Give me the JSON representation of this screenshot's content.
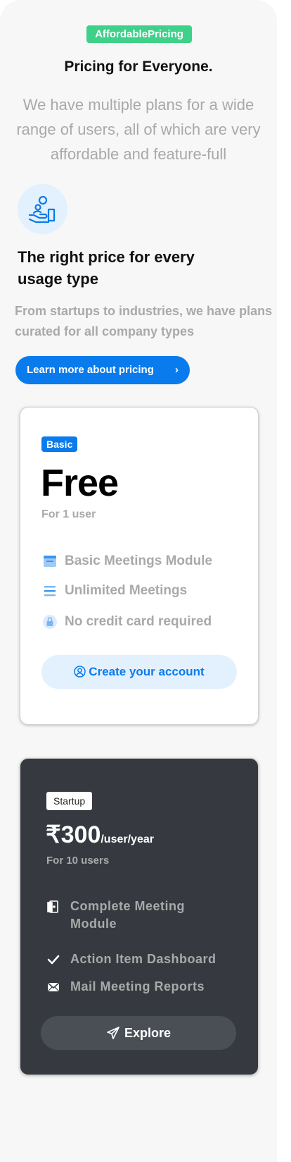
{
  "header": {
    "pill": "AffordablePricing",
    "title": "Pricing for Everyone.",
    "subtitle": "We have multiple plans for a wide range of users, all of which are very affordable and feature-full"
  },
  "feature_block": {
    "icon": "hand-coins-icon",
    "heading": "The right price for every usage type",
    "description": "From startups to industries, we have plans curated for all company types",
    "cta_label": "Learn more about pricing"
  },
  "plans": {
    "basic": {
      "badge": "Basic",
      "price": "Free",
      "users": "For 1 user",
      "features": [
        {
          "icon": "meeting-window-icon",
          "label": "Basic Meetings Module"
        },
        {
          "icon": "list-lines-icon",
          "label": "Unlimited Meetings"
        },
        {
          "icon": "lock-badge-icon",
          "label": "No credit card required"
        }
      ],
      "cta_label": "Create your account"
    },
    "startup": {
      "badge": "Startup",
      "price_amount": "₹300",
      "price_period": "/user/year",
      "users": "For 10 users",
      "features": [
        {
          "icon": "door-icon",
          "label": "Complete Meeting Module"
        },
        {
          "icon": "checkmark-icon",
          "label": "Action Item Dashboard"
        },
        {
          "icon": "mail-icon",
          "label": "Mail Meeting Reports"
        }
      ],
      "cta_label": "Explore"
    }
  },
  "colors": {
    "accent": "#0a7bec",
    "pill_green": "#3fd08a",
    "dark_card": "#363a40",
    "muted_text": "#a9a9a9"
  }
}
